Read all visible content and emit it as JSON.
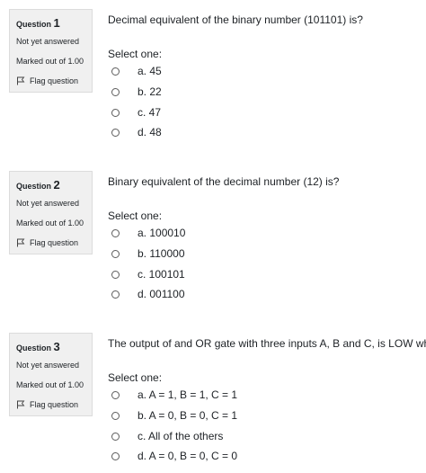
{
  "questions": [
    {
      "label": "Question",
      "number": "1",
      "status": "Not yet answered",
      "marked": "Marked out of 1.00",
      "flag_label": "Flag question",
      "text": "Decimal equivalent of the binary number (101101) is?",
      "select_label": "Select one:",
      "options": [
        "a. 45",
        "b. 22",
        "c. 47",
        "d. 48"
      ]
    },
    {
      "label": "Question",
      "number": "2",
      "status": "Not yet answered",
      "marked": "Marked out of 1.00",
      "flag_label": "Flag question",
      "text": "Binary equivalent of the decimal number (12) is?",
      "select_label": "Select one:",
      "options": [
        "a. 100010",
        "b. 110000",
        "c. 100101",
        "d. 001100"
      ]
    },
    {
      "label": "Question",
      "number": "3",
      "status": "Not yet answered",
      "marked": "Marked out of 1.00",
      "flag_label": "Flag question",
      "text": "The output of and OR gate with three inputs A, B and C, is LOW when",
      "select_label": "Select one:",
      "options": [
        "a. A = 1, B = 1, C = 1",
        "b. A = 0, B = 0, C = 1",
        "c. All of the others",
        "d. A = 0, B = 0, C = 0"
      ]
    }
  ]
}
